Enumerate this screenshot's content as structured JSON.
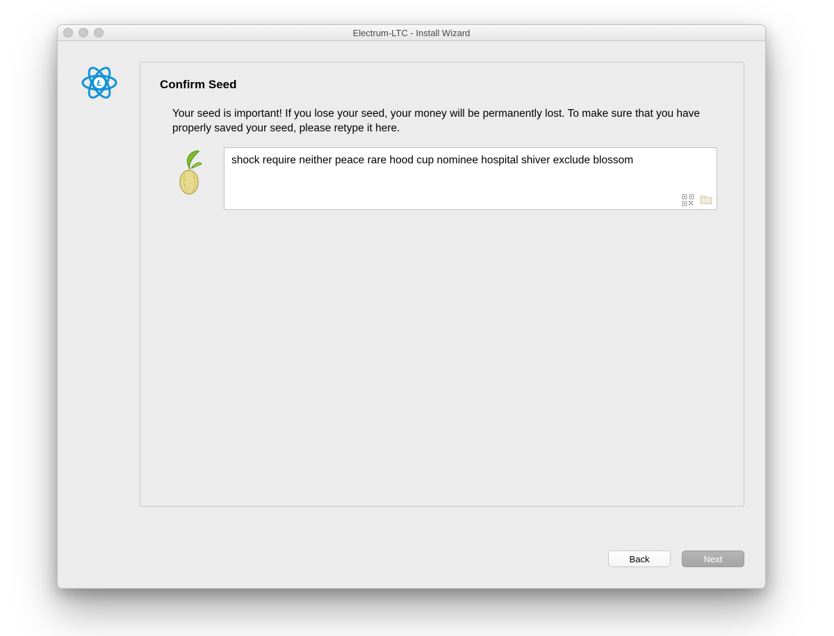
{
  "window": {
    "title": "Electrum-LTC  -  Install Wizard"
  },
  "panel": {
    "heading": "Confirm Seed",
    "instructions": "Your seed is important! If you lose your seed, your money will be permanently lost. To make sure that you have properly saved your seed, please retype it here.",
    "seed_value": "shock require neither peace rare hood cup nominee hospital shiver exclude blossom"
  },
  "buttons": {
    "back": "Back",
    "next": "Next"
  },
  "icons": {
    "app_logo": "electrum-ltc-logo",
    "seed": "seed-sprout-icon",
    "qr": "qr-code-icon",
    "folder": "folder-icon"
  },
  "colors": {
    "accent": "#1393d6",
    "window_bg": "#ececec"
  }
}
